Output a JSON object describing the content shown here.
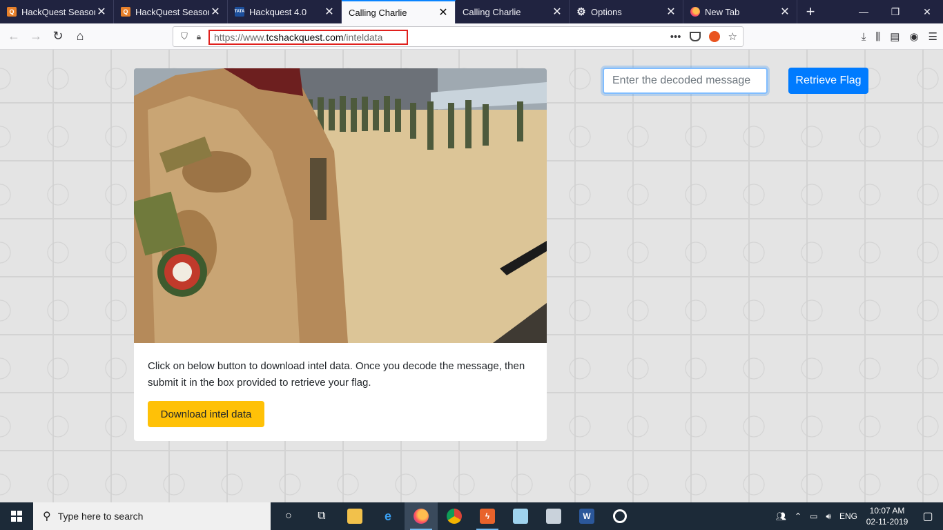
{
  "browser": {
    "tabs": [
      {
        "label": "HackQuest Season",
        "icon": "hackquest-icon",
        "active": false
      },
      {
        "label": "HackQuest Season",
        "icon": "hackquest-icon",
        "active": false
      },
      {
        "label": "Hackquest 4.0",
        "icon": "tata-icon",
        "active": false
      },
      {
        "label": "Calling Charlie",
        "icon": "none",
        "active": true
      },
      {
        "label": "Calling Charlie",
        "icon": "none",
        "active": false
      },
      {
        "label": "Options",
        "icon": "gear-icon",
        "active": false
      },
      {
        "label": "New Tab",
        "icon": "firefox-icon",
        "active": false
      }
    ],
    "tata_badge": "TATA",
    "hq_badge": "Q",
    "newtab_glyph": "+",
    "close_glyph": "✕",
    "url_prefix": "https://www.",
    "url_host": "tcshackquest.com",
    "url_path": "/inteldata",
    "url_highlight_color": "#e0201d"
  },
  "page": {
    "description": "Click on below button to download intel data. Once you decode the message, then submit it in the box provided to retrieve your flag.",
    "download_button": "Download intel data",
    "input_placeholder": "Enter the decoded message",
    "retrieve_button": "Retrieve Flag",
    "accent_blue": "#007bff",
    "accent_yellow": "#ffc107"
  },
  "taskbar": {
    "search_placeholder": "Type here to search",
    "language": "ENG",
    "time": "10:07 AM",
    "date": "02-11-2019"
  }
}
